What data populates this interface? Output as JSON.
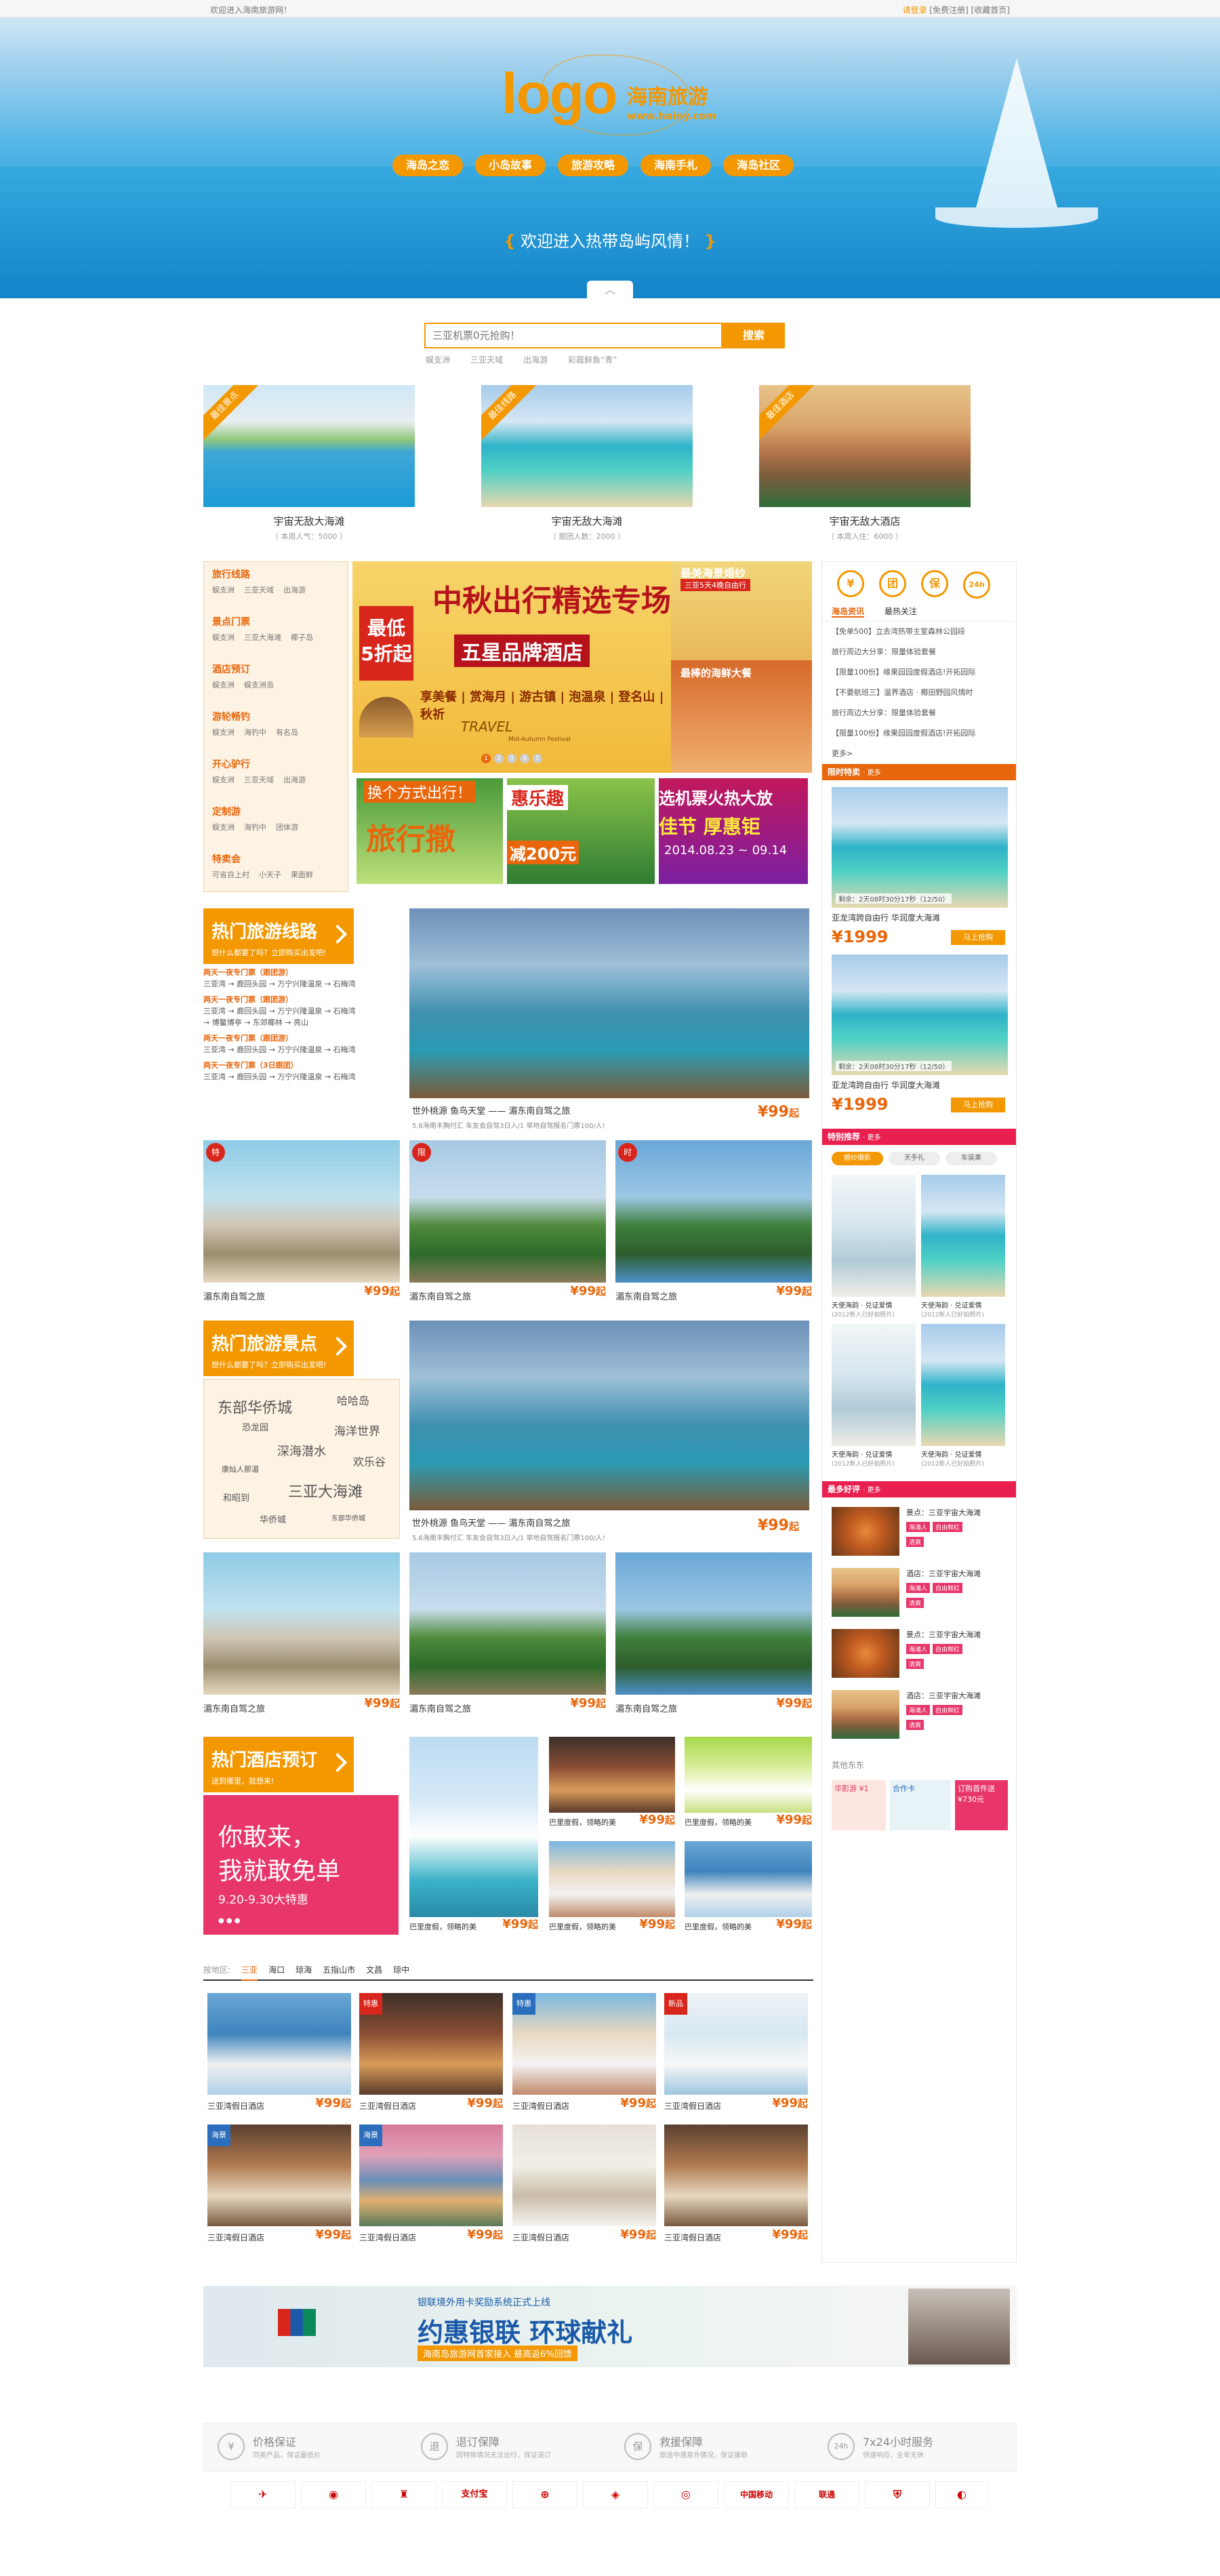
{
  "topbar": {
    "welcome": "欢迎进入海南旅游网！",
    "login": "请登录",
    "register": "[免费注册]",
    "favorite": "[收藏首页]"
  },
  "logo": {
    "text": "logo",
    "cn": "海南旅游",
    "url": "www.hainy.com"
  },
  "nav": [
    "海岛之恋",
    "小岛故事",
    "旅游攻略",
    "海南手札",
    "海岛社区"
  ],
  "welcome": {
    "open": "{",
    "text": "欢迎进入热带岛屿风情！",
    "close": "}"
  },
  "collapse": "︿",
  "search": {
    "placeholder": "三亚机票0元抢购！",
    "button": "搜索",
    "hotwords": [
      "蜈支洲",
      "三亚天域",
      "出海游",
      "彩霞鲜鱼“青”"
    ]
  },
  "featured": [
    {
      "ribbon": "最佳景点",
      "title": "宇宙无敌大海滩",
      "sub": "（ 本周人气：5000 ）"
    },
    {
      "ribbon": "最佳线路",
      "title": "宇宙无敌大海滩",
      "sub": "（ 跟团人数：2000 ）"
    },
    {
      "ribbon": "最佳酒店",
      "title": "宇宙无敌大酒店",
      "sub": "（ 本周入住：6000 ）"
    }
  ],
  "categories": [
    {
      "h": "旅行线路",
      "items": [
        "蜈支洲",
        "三亚天域",
        "出海游"
      ]
    },
    {
      "h": "景点门票",
      "items": [
        "蜈支洲",
        "三亚大海滩",
        "椰子岛"
      ]
    },
    {
      "h": "酒店预订",
      "items": [
        "蜈支洲",
        "蜈支洲岛"
      ]
    },
    {
      "h": "游轮畅钓",
      "items": [
        "蜈支洲",
        "海钓中",
        "有名岛"
      ]
    },
    {
      "h": "开心驴行",
      "items": [
        "蜈支洲",
        "三亚天域",
        "出海游"
      ]
    },
    {
      "h": "定制游",
      "items": [
        "蜈支洲",
        "海钓中",
        "团体游"
      ]
    },
    {
      "h": "特卖会",
      "items": [
        "可省自上村",
        "小天子",
        "果面鲜"
      ]
    }
  ],
  "promo": {
    "discount": "最低 5折起",
    "title": "中秋出行精选专场",
    "sub": "五星品牌酒店",
    "line": "享美餐 | 赏海月 | 游古镇 | 泡温泉 | 登名山 | 秋祈",
    "travel": "TRAVEL",
    "fest": "Mid-Autumn Festival",
    "dots": [
      "1",
      "2",
      "3",
      "4",
      "5"
    ]
  },
  "sidepromo": {
    "a": "最美海景婚纱",
    "a2": "三亚5天4晚自由行",
    "b": "最棒的海鲜大餐"
  },
  "smallbanners": [
    {
      "a": "换个方式出行！",
      "b": "旅行撒"
    },
    {
      "a": "惠乐趣",
      "b": "减200元"
    },
    {
      "a": "选机票火热大放",
      "b": "佳节 厚惠钜",
      "c": "2014.08.23 ~ 09.14"
    }
  ],
  "routes_section": {
    "title": "热门旅游线路",
    "sub": "想什么都要了吗？立即购买出发吧!",
    "routes": [
      {
        "t": "两天一夜专门票（跟团游）",
        "lines": [
          "三亚湾 → 鹿回头园 → 万宁兴隆温泉 → 石梅湾"
        ]
      },
      {
        "t": "两天一夜专门票（跟团游）",
        "lines": [
          "三亚湾 → 鹿回头园 → 万宁兴隆温泉 → 石梅湾",
          "→ 博鳌博亭 → 东郊椰林 → 亮山"
        ]
      },
      {
        "t": "两天一夜专门票（跟团游）",
        "lines": [
          "三亚湾 → 鹿回头园 → 万宁兴隆温泉 → 石梅湾"
        ]
      },
      {
        "t": "两天一夜专门票（3日跟团）",
        "lines": [
          "三亚湾 → 鹿回头园 → 万宁兴隆温泉 → 石梅湾"
        ]
      }
    ]
  },
  "big1": {
    "cap": "世外桃源  鱼鸟天堂 —— 湄东南自驾之旅",
    "sub": "5.6海南丰胸付汇 车友会自驾3日入/1 举地自驾报名门票100/人!",
    "price": "¥99",
    "unit": "起"
  },
  "cards1": [
    {
      "tag": "特",
      "cap": "湄东南自驾之旅",
      "price": "¥99",
      "unit": "起"
    },
    {
      "tag": "限",
      "cap": "湄东南自驾之旅",
      "price": "¥99",
      "unit": "起"
    },
    {
      "tag": "时",
      "cap": "湄东南自驾之旅",
      "price": "¥99",
      "unit": "起"
    }
  ],
  "spots_section": {
    "title": "热门旅游景点",
    "sub": "想什么都要了吗？立即购买出发吧!",
    "cloud": [
      "东部华侨城",
      "哈哈岛",
      "恐龙园",
      "海洋世界",
      "深海潜水",
      "欢乐谷",
      "康灿人那湄",
      "三亚大海滩",
      "和昭到",
      "华侨城",
      "东部华侨城"
    ]
  },
  "big2": {
    "cap": "世外桃源  鱼鸟天堂 —— 湄东南自驾之旅",
    "sub": "5.6海南丰胸付汇 车友会自驾3日入/1 举地自驾报名门票100/人!",
    "price": "¥99",
    "unit": "起"
  },
  "cards2": [
    {
      "cap": "湄东南自驾之旅",
      "price": "¥99",
      "unit": "起"
    },
    {
      "cap": "湄东南自驾之旅",
      "price": "¥99",
      "unit": "起"
    },
    {
      "cap": "湄东南自驾之旅",
      "price": "¥99",
      "unit": "起"
    }
  ],
  "hotel_section": {
    "title": "热门酒店预订",
    "sub": "送到哪里，就想来!",
    "promo_a": "你敢来，",
    "promo_b": "我就敢免单",
    "promo_c": "9.20-9.30大特惠",
    "promo_dots": "● ● ●"
  },
  "hotel_grid": [
    {
      "cap": "巴里度假，领略的美",
      "price": "¥99",
      "unit": "起"
    },
    {
      "cap": "巴里度假，领略的美",
      "price": "¥99",
      "unit": "起"
    },
    {
      "cap": "巴里度假，领略的美",
      "price": "¥99",
      "unit": "起"
    },
    {
      "cap": "巴里度假，领略的美",
      "price": "¥99",
      "unit": "起"
    },
    {
      "cap": "巴里度假，领略的美",
      "price": "¥99",
      "unit": "起"
    }
  ],
  "hotel_tabs": {
    "label": "按地区:",
    "tabs": [
      "三亚",
      "海口",
      "琼海",
      "五指山市",
      "文昌",
      "琼中"
    ]
  },
  "hotel_cards": [
    {
      "tag": "",
      "cap": "三亚湾假日酒店",
      "price": "¥99",
      "unit": "起"
    },
    {
      "tag": "特惠",
      "cap": "三亚湾假日酒店",
      "price": "¥99",
      "unit": "起"
    },
    {
      "tag": "特惠",
      "cap": "三亚湾假日酒店",
      "price": "¥99",
      "unit": "起"
    },
    {
      "tag": "新品",
      "cap": "三亚湾假日酒店",
      "price": "¥99",
      "unit": "起"
    },
    {
      "tag": "海景",
      "cap": "三亚湾假日酒店",
      "price": "¥99",
      "unit": "起"
    },
    {
      "tag": "海景",
      "cap": "三亚湾假日酒店",
      "price": "¥99",
      "unit": "起"
    },
    {
      "tag": "",
      "cap": "三亚湾假日酒店",
      "price": "¥99",
      "unit": "起"
    },
    {
      "tag": "",
      "cap": "三亚湾假日酒店",
      "price": "¥99",
      "unit": "起"
    }
  ],
  "right": {
    "services": [
      "¥",
      "团",
      "保",
      "24h"
    ],
    "tabs": [
      "海岛资讯",
      "最热关注"
    ],
    "news": [
      "【免单500】立去湾热带主室森林公园段",
      "旅行周边大分享：限量体验套餐",
      "【限量100份】缘果园园度假酒店!开拓园际",
      "【不要航班三】温界酒店 · 椰田野园风情时",
      "旅行周边大分享：限量体验套餐",
      "【限量100份】缘果园园度假酒店!开拓园际"
    ],
    "more": "更多>",
    "sale_h": "限时特卖",
    "sale_more": "· 更多",
    "sale": [
      {
        "hint": "剩余：2天08时30分17秒（12/50）",
        "cap": "亚龙湾跨自由行  华润度大海滩",
        "price": "¥1999",
        "buy": "马上抢购"
      },
      {
        "hint": "剩余：2天08时30分17秒（12/50）",
        "cap": "亚龙湾跨自由行  华润度大海滩",
        "price": "¥1999",
        "buy": "马上抢购"
      }
    ],
    "special_h": "特别推荐",
    "special_more": "· 更多",
    "pills": [
      "婚纱摄影",
      "天手礼",
      "车装果"
    ],
    "brides": [
      {
        "t": "天使海韵 · 兑证爱情",
        "s": "(2012新人已好拍照片)"
      },
      {
        "t": "天使海韵 · 兑证爱情",
        "s": "(2012新人已好拍照片)"
      },
      {
        "t": "天使海韵 · 兑证爱情",
        "s": "(2012新人已好拍照片)"
      },
      {
        "t": "天使海韵 · 兑证爱情",
        "s": "(2012新人已好拍照片)"
      }
    ],
    "eat_h": "最多好评",
    "eat_more": "· 更多",
    "eats": [
      {
        "t": "景点：三亚宇宙大海滩",
        "c": [
          "海滩人",
          "自由鲜红",
          "清爽"
        ]
      },
      {
        "t": "酒店：三亚宇宙大海滩",
        "c": [
          "海滩人",
          "自由鲜红",
          "清爽"
        ]
      },
      {
        "t": "景点：三亚宇宙大海滩",
        "c": [
          "海滩人",
          "自由鲜红",
          "清爽"
        ]
      },
      {
        "t": "酒店：三亚宇宙大海滩",
        "c": [
          "海滩人",
          "自由鲜红",
          "清爽"
        ]
      }
    ],
    "other_h": "其他东东",
    "other": [
      "华影游 ¥1",
      "合作卡",
      "订购首件送¥730元"
    ]
  },
  "unionpay": {
    "a": "银联境外用卡奖励系统正式上线",
    "b": "约惠银联  环球献礼",
    "c": "海南岛旅游网首家接入  最高返6%回馈"
  },
  "guarantees": [
    {
      "ic": "¥",
      "h": "价格保证",
      "s": "同类产品，保证最低价"
    },
    {
      "ic": "退",
      "h": "退订保障",
      "s": "因特殊情况无法出行，保证退订"
    },
    {
      "ic": "保",
      "h": "救援保障",
      "s": "旅途中遇意外情况，保证援助"
    },
    {
      "ic": "24h",
      "h": "7x24小时服务",
      "s": "快速响应，全年无休"
    }
  ],
  "partners": [
    "✈",
    "◉",
    "♜",
    "支付宝",
    "⊕",
    "◈",
    "◎",
    "中国移动",
    "联通",
    "⛨",
    "◐"
  ]
}
